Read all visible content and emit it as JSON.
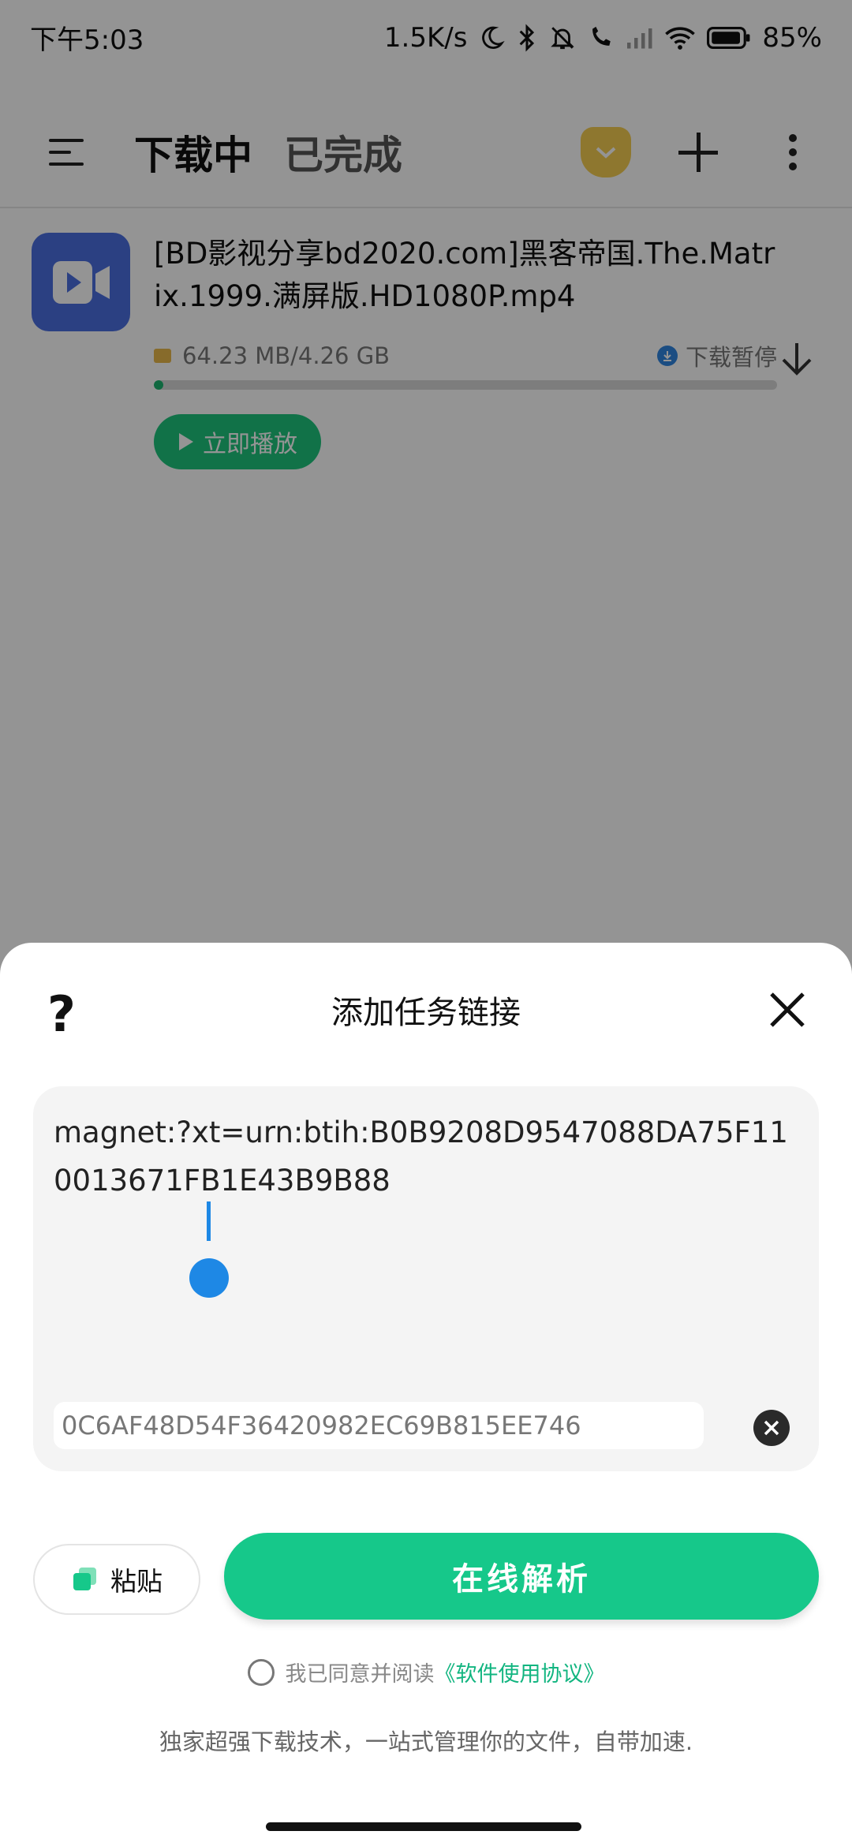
{
  "status_bar": {
    "time": "下午5:03",
    "net_speed": "1.5K/s",
    "battery": "85%",
    "icons": [
      "moon-icon",
      "bluetooth-icon",
      "mute-icon",
      "call-icon",
      "signal-icon",
      "wifi-icon",
      "battery-icon"
    ]
  },
  "toolbar": {
    "tab_downloading": "下载中",
    "tab_completed": "已完成",
    "icons": [
      "menu-icon",
      "vip-badge-icon",
      "add-icon",
      "more-icon"
    ]
  },
  "task": {
    "title": "[BD影视分享bd2020.com]黑客帝国.The.Matrix.1999.满屏版.HD1080P.mp4",
    "size": "64.23 MB/4.26 GB",
    "status": "下载暂停",
    "progress_fraction": 0.015,
    "play_label": "立即播放",
    "icon": "video-icon"
  },
  "sheet": {
    "help": "?",
    "title": "添加任务链接",
    "link_value": "magnet:?xt=urn:btih:B0B9208D9547088DA75F110013671FB1E43B9B88",
    "hash_value": "0C6AF48D54F36420982EC69B815EE746",
    "paste_label": "粘贴",
    "parse_label": "在线解析",
    "agree_text": "我已同意并阅读",
    "agree_link": "《软件使用协议》",
    "slogan": "独家超强下载技术，一站式管理你的文件，自带加速."
  },
  "colors": {
    "accent_green": "#16c88a",
    "cursor_blue": "#1e88e5",
    "video_icon_blue": "#4a6fe0",
    "vip_gold": "#f5cd52"
  }
}
